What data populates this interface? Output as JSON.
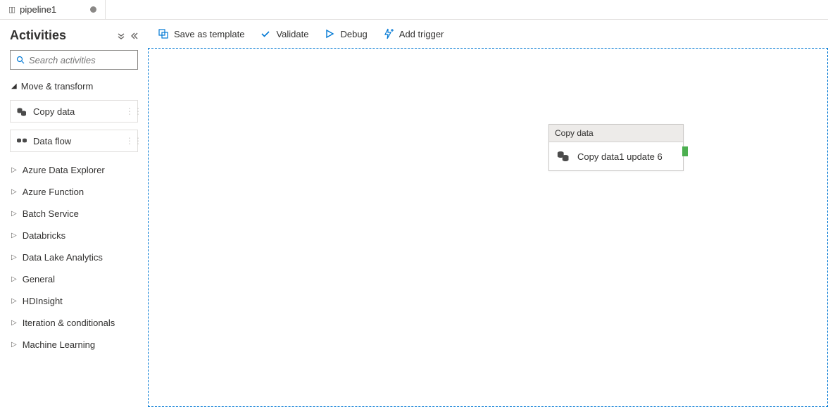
{
  "tab": {
    "label": "pipeline1"
  },
  "sidebar": {
    "title": "Activities",
    "search_placeholder": "Search activities",
    "expanded_category": "Move & transform",
    "activities": [
      {
        "label": "Copy data"
      },
      {
        "label": "Data flow"
      }
    ],
    "categories": [
      {
        "label": "Azure Data Explorer"
      },
      {
        "label": "Azure Function"
      },
      {
        "label": "Batch Service"
      },
      {
        "label": "Databricks"
      },
      {
        "label": "Data Lake Analytics"
      },
      {
        "label": "General"
      },
      {
        "label": "HDInsight"
      },
      {
        "label": "Iteration & conditionals"
      },
      {
        "label": "Machine Learning"
      }
    ]
  },
  "toolbar": {
    "save_template": "Save as template",
    "validate": "Validate",
    "debug": "Debug",
    "add_trigger": "Add trigger"
  },
  "node": {
    "type": "Copy data",
    "name": "Copy data1 update 6"
  }
}
